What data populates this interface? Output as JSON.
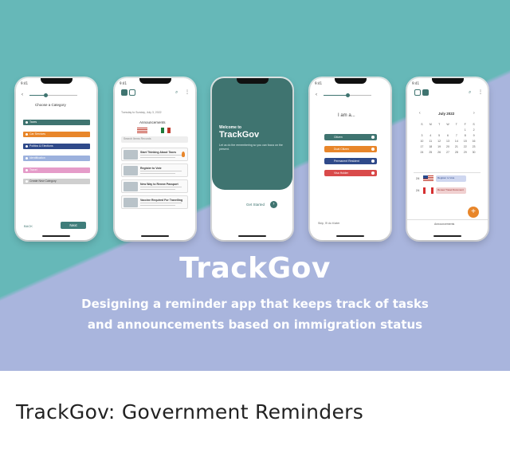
{
  "hero": {
    "title": "TrackGov",
    "tagline_line1": "Designing a reminder app that keeps track of tasks",
    "tagline_line2": "and announcements based on immigration status",
    "colors": {
      "teal": "#66b8b8",
      "periwinkle": "#a9b5dd",
      "dark_teal": "#3f7470"
    }
  },
  "caption": "TrackGov: Government Reminders",
  "phones": {
    "status_time": "9:41",
    "category": {
      "heading": "Choose a Category",
      "items": [
        "Taxes",
        "Car Services",
        "Politics & Elections",
        "Identification",
        "Travel",
        "Create New Category"
      ],
      "back": "BACK",
      "next": "Next"
    },
    "announcements": {
      "date": "Tuesday to Sunday, July 3, 2022",
      "heading": "Announcements",
      "search": "Search Items Records",
      "items": [
        "Start Thinking About Taxes",
        "Register to Vote",
        "New Way to Renew Passport",
        "Vaccine Required For Travelling"
      ]
    },
    "welcome": {
      "line1": "Welcome to",
      "line2": "TrackGov",
      "sub": "Let us do the remembering so you can focus on the present.",
      "cta": "Get Started"
    },
    "role": {
      "heading": "I am a...",
      "options": [
        "Citizen",
        "Dual Citizen",
        "Permanent Resident",
        "Visa Holder"
      ],
      "skip": "Skip, I'll do it later"
    },
    "calendar": {
      "month": "July 2022",
      "weekdays": [
        "S",
        "M",
        "T",
        "W",
        "T",
        "F",
        "S"
      ],
      "days": [
        "",
        "",
        "",
        "",
        "",
        "1",
        "2",
        "3",
        "4",
        "5",
        "6",
        "7",
        "8",
        "9",
        "10",
        "11",
        "12",
        "13",
        "14",
        "15",
        "16",
        "17",
        "18",
        "19",
        "20",
        "21",
        "22",
        "23",
        "24",
        "25",
        "26",
        "27",
        "28",
        "29",
        "30"
      ],
      "events": [
        {
          "day": "24",
          "label": "Register to Vote"
        },
        {
          "day": "24",
          "label": "Renew Travel Document"
        }
      ],
      "footer": "Announcements",
      "fab": "+"
    }
  }
}
